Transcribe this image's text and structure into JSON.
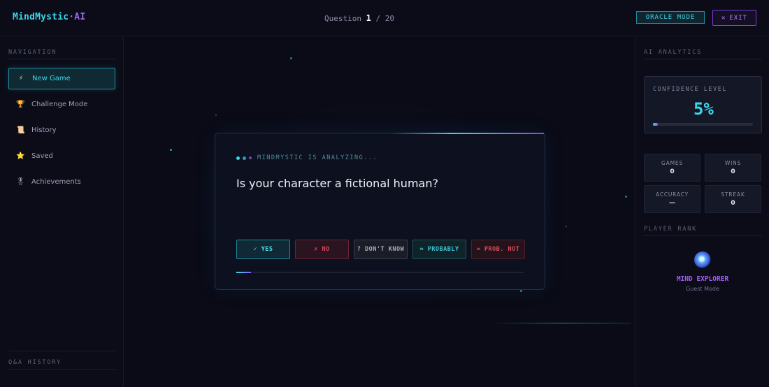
{
  "header": {
    "logo_main": "MindMystic",
    "logo_suffix": "·AI",
    "question_prefix": "Question",
    "question_current": "1",
    "question_total": "/ 20",
    "oracle_label": "ORACLE MODE",
    "exit_icon": "✕",
    "exit_label": "EXIT"
  },
  "sidebar": {
    "nav_title": "NAVIGATION",
    "items": [
      {
        "label": "New Game",
        "icon": "⚡",
        "icon_name": "lightning-icon"
      },
      {
        "label": "Challenge Mode",
        "icon": "🏆",
        "icon_name": "trophy-icon"
      },
      {
        "label": "History",
        "icon": "📜",
        "icon_name": "scroll-icon"
      },
      {
        "label": "Saved",
        "icon": "⭐",
        "icon_name": "star-icon"
      },
      {
        "label": "Achievements",
        "icon": "🎖",
        "icon_name": "medal-icon"
      }
    ],
    "history_title": "Q&A HISTORY"
  },
  "card": {
    "status": "MINDMYSTIC IS ANALYZING...",
    "question": "Is your character a fictional human?",
    "answers": {
      "yes": "✓ YES",
      "no": "✗ NO",
      "dont_know": "? DON'T KNOW",
      "probably": "≈ PROBABLY",
      "prob_not": "≈ PROB. NOT"
    },
    "progress": 0.05
  },
  "analytics": {
    "title": "AI ANALYTICS",
    "confidence_label": "CONFIDENCE LEVEL",
    "confidence_value": "5%",
    "confidence_fraction": 0.05,
    "stats": [
      {
        "label": "GAMES",
        "value": "0"
      },
      {
        "label": "WINS",
        "value": "0"
      },
      {
        "label": "ACCURACY",
        "value": "—"
      },
      {
        "label": "STREAK",
        "value": "0"
      }
    ],
    "rank_title": "PLAYER RANK",
    "rank_name": "MIND EXPLORER",
    "rank_mode": "Guest Mode"
  },
  "colors": {
    "accent_cyan": "#38d6ec",
    "accent_purple": "#8a5cf0",
    "background": "#0a0b16"
  }
}
